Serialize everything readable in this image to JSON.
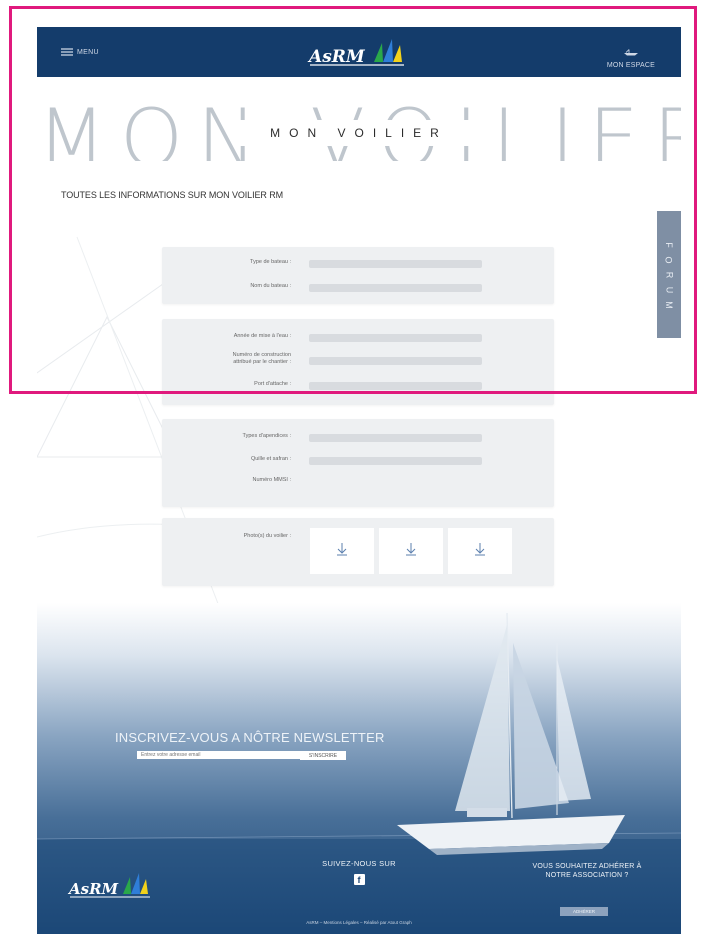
{
  "header": {
    "menu_label": "MENU",
    "logo_text": "AsRM",
    "account_label": "MON ESPACE"
  },
  "hero": {
    "big_title": "MON VOILIER",
    "subtitle": "MON VOILIER"
  },
  "intro_text": "TOUTES LES INFORMATIONS SUR MON VOILIER RM",
  "forum_tab": {
    "letters": [
      "F",
      "O",
      "R",
      "U",
      "M"
    ]
  },
  "sections": {
    "s1": {
      "type_bateau": "Type de bateau :",
      "nom_bateau": "Nom du bateau :"
    },
    "s2": {
      "annee": "Année de mise à l'eau :",
      "numero_line1": "Numéro de construction",
      "numero_line2": "attribué par le chantier :",
      "port": "Port d'attache :"
    },
    "s3": {
      "appendices": "Types d'apendices :",
      "quille": "Quille et safran :",
      "mmsi": "Numéro MMSI :"
    },
    "s4": {
      "photos": "Photo(s) du voilier :"
    }
  },
  "newsletter": {
    "title": "INSCRIVEZ-VOUS A NÔTRE NEWSLETTER",
    "placeholder": "Entrez votre adresse email",
    "button": "S'INSCRIRE"
  },
  "footer": {
    "follow": "SUIVEZ-NOUS SUR",
    "facebook_glyph": "f",
    "join_line1": "VOUS SOUHAITEZ ADHÉRER À",
    "join_line2": "NOTRE ASSOCIATION ?",
    "join_button": "ADHÉRER",
    "logo_text": "AsRM",
    "legal_brand": "AsRM",
    "legal_link": "Mentions Légales",
    "legal_credit": "Réalisé par Atout Graph",
    "legal_sep": " – "
  },
  "colors": {
    "navy": "#143c6b",
    "forum_tab": "#7f8fa4",
    "card": "#eef0f2",
    "field": "#d8dbdf",
    "annotation": "#e0197d"
  },
  "icons": {
    "menu": "hamburger-icon",
    "account": "sailboat-icon",
    "upload": "download-arrow-icon"
  }
}
